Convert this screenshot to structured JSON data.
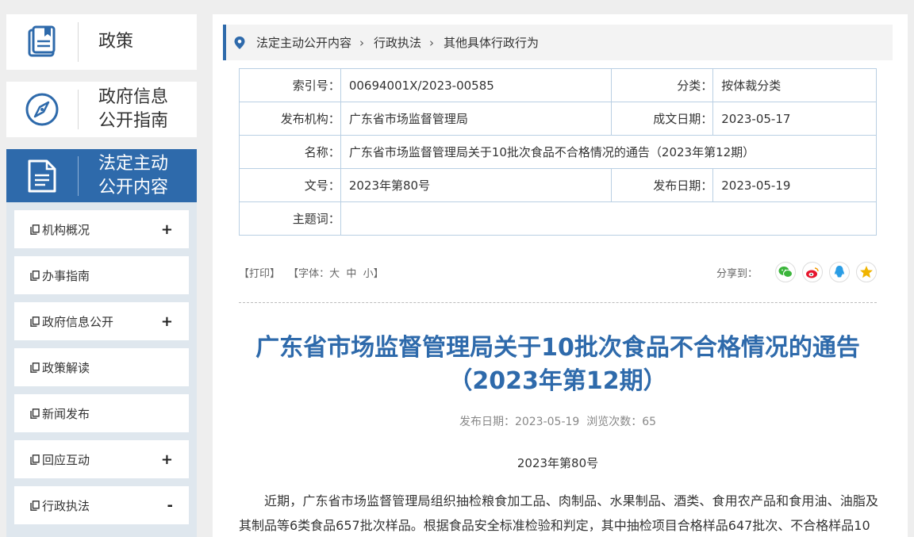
{
  "sidebar": {
    "categories": [
      {
        "label": "政策",
        "icon": "book-icon"
      },
      {
        "label": "政府信息\n公开指南",
        "icon": "compass-icon"
      },
      {
        "label": "法定主动\n公开内容",
        "icon": "document-icon"
      }
    ],
    "items": [
      {
        "label": "机构概况",
        "toggle": "+"
      },
      {
        "label": "办事指南",
        "toggle": ""
      },
      {
        "label": "政府信息公开",
        "toggle": "+"
      },
      {
        "label": "政策解读",
        "toggle": ""
      },
      {
        "label": "新闻发布",
        "toggle": ""
      },
      {
        "label": "回应互动",
        "toggle": "+"
      },
      {
        "label": "行政执法",
        "toggle": "-"
      }
    ]
  },
  "breadcrumb": [
    "法定主动公开内容",
    "行政执法",
    "其他具体行政行为"
  ],
  "meta": {
    "index_label": "索引号：",
    "index_value": "00694001X/2023-00585",
    "category_label": "分类：",
    "category_value": "按体裁分类",
    "publisher_label": "发布机构：",
    "publisher_value": "广东省市场监督管理局",
    "written_date_label": "成文日期：",
    "written_date_value": "2023-05-17",
    "name_label": "名称：",
    "name_value": "广东省市场监督管理局关于10批次食品不合格情况的通告（2023年第12期）",
    "docno_label": "文号：",
    "docno_value": "2023年第80号",
    "pub_date_label": "发布日期：",
    "pub_date_value": "2023-05-19",
    "keywords_label": "主题词：",
    "keywords_value": ""
  },
  "tools": {
    "print": "【打印】",
    "font": "【字体：大  中  小】",
    "share_label": "分享到："
  },
  "article": {
    "title": "广东省市场监督管理局关于10批次食品不合格情况的通告（2023年第12期）",
    "pub_info": "发布日期：2023-05-19  浏览次数：65",
    "doc_no": "2023年第80号",
    "body": "近期，广东省市场监督管理局组织抽检粮食加工品、肉制品、水果制品、酒类、食用农产品和食用油、油脂及其制品等6类食品657批次样品。根据食品安全标准检验和判定，其中抽检项目合格样品647批次、不合格样品10"
  },
  "colors": {
    "accent": "#2e6aab",
    "wechat": "#3bb53b",
    "weibo": "#e6162d",
    "qq": "#2a9de5",
    "qzone": "#f0b400"
  }
}
